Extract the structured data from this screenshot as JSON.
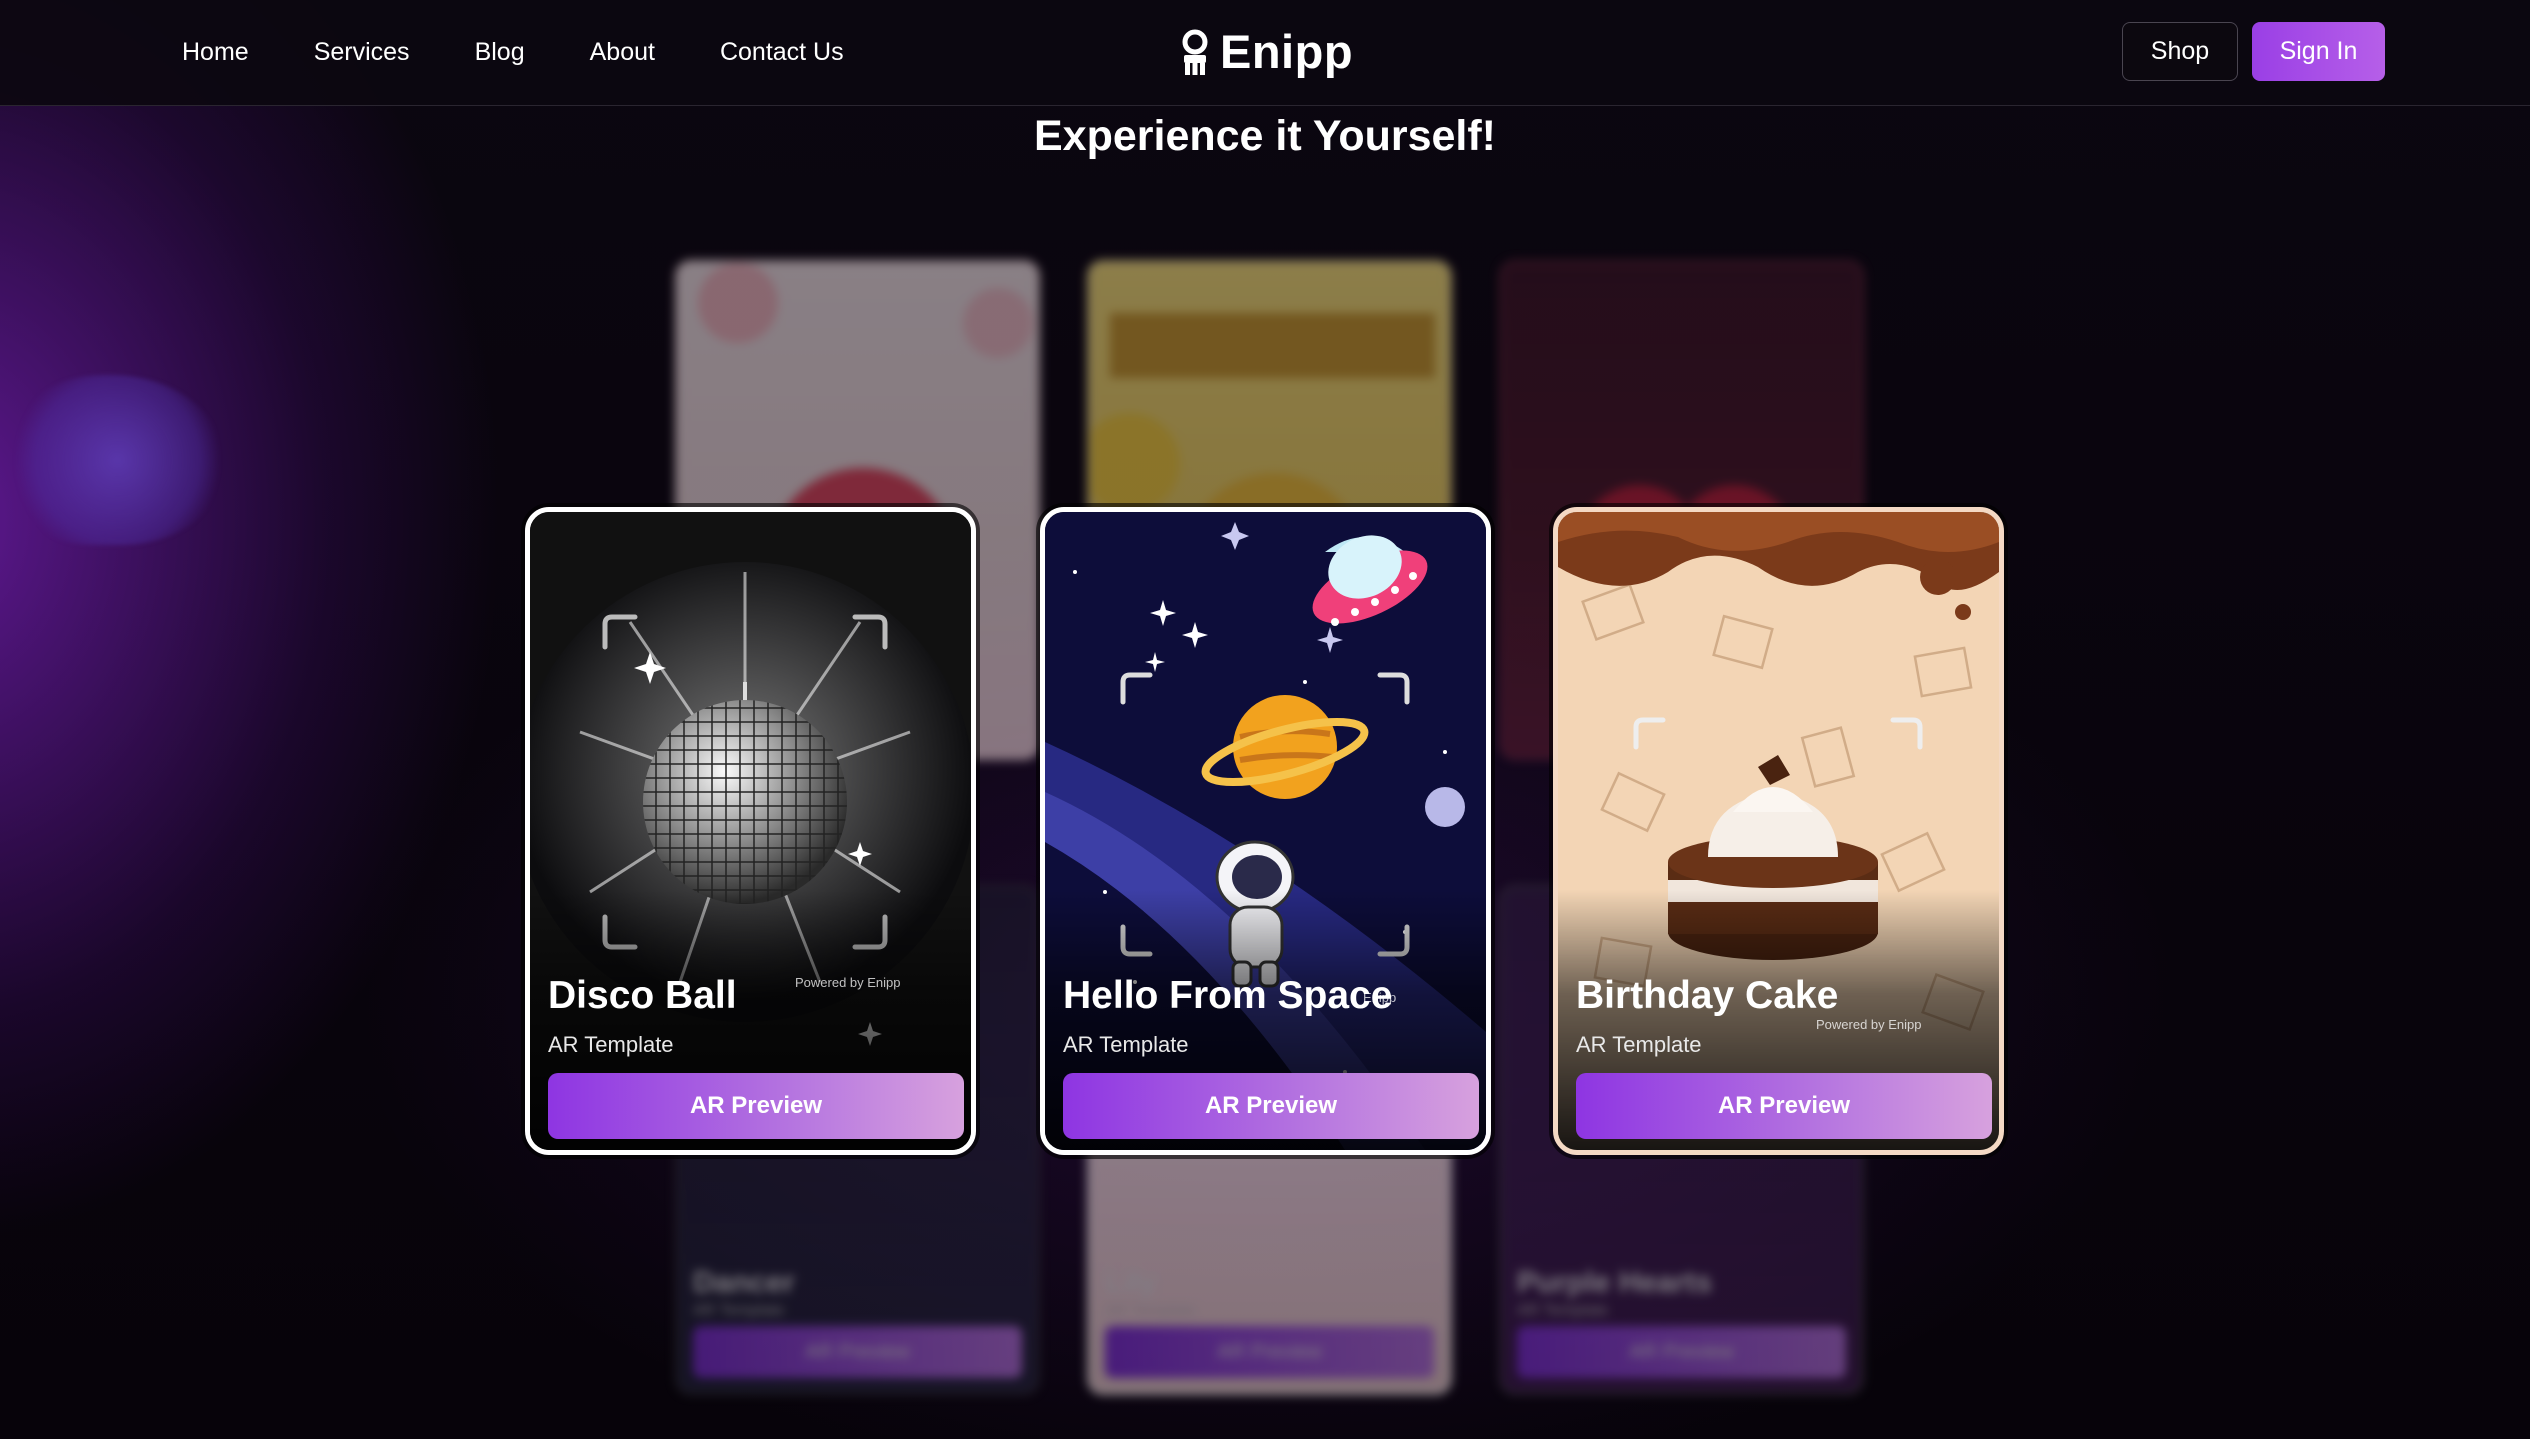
{
  "nav": {
    "items": [
      {
        "label": "Home"
      },
      {
        "label": "Services"
      },
      {
        "label": "Blog"
      },
      {
        "label": "About"
      },
      {
        "label": "Contact Us"
      }
    ]
  },
  "brand": {
    "name": "Enipp",
    "logo_icon": "enipp-logo-icon"
  },
  "header_actions": {
    "shop_label": "Shop",
    "signin_label": "Sign In"
  },
  "section": {
    "heading": "Experience it Yourself!"
  },
  "featured_cards": [
    {
      "title": "Disco Ball",
      "subtitle": "AR Template",
      "button": "AR Preview",
      "watermark": "Powered by Enipp"
    },
    {
      "title": "Hello From Space",
      "subtitle": "AR Template",
      "button": "AR Preview",
      "watermark": "Enipp"
    },
    {
      "title": "Birthday Cake",
      "subtitle": "AR Template",
      "button": "AR Preview",
      "watermark": "Powered by Enipp"
    }
  ],
  "background_cards": [
    {
      "title": "Dancer",
      "subtitle": "AR Template",
      "button": "AR Preview"
    },
    {
      "title": "Lily",
      "subtitle": "AR Template",
      "button": "AR Preview"
    },
    {
      "title": "Purple Hearts",
      "subtitle": "AR Template",
      "button": "AR Preview"
    }
  ],
  "colors": {
    "accent": "#9a3fe6",
    "accent_light": "#d7a1de",
    "background": "#070309",
    "text": "#ffffff"
  }
}
